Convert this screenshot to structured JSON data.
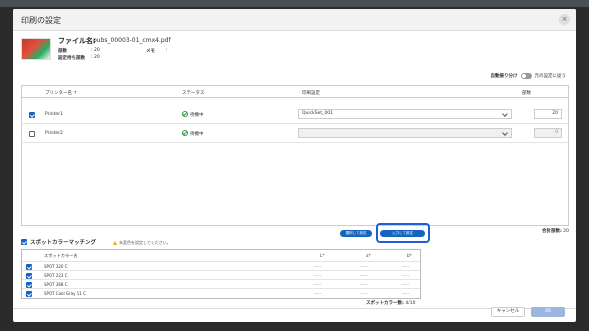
{
  "dialog": {
    "title": "印刷の設定",
    "close_label": "×"
  },
  "file": {
    "label": "ファイル名:",
    "name": "pubs_00003-01_cmx4.pdf",
    "copies_label": "部数",
    "copies_value": "20",
    "memo_label": "メモ",
    "memo_value": ":",
    "quota_label": "設定待ち部数",
    "quota_value": "20"
  },
  "auto_assign": {
    "label": "自動振り分け",
    "value_label": "元の設定に従う"
  },
  "printers": {
    "columns": [
      "プリンター名 ↑",
      "ステータス",
      "印刷設定",
      "部数"
    ],
    "rows": [
      {
        "checked": true,
        "name": "Printer1",
        "status": "待機中",
        "setting": "QuickSet_001",
        "copies": "20",
        "disabled": false
      },
      {
        "checked": false,
        "name": "Printer2",
        "status": "待機中",
        "setting": "",
        "copies": "0",
        "disabled": true
      }
    ]
  },
  "total": {
    "label": "合計部数:",
    "value": "20"
  },
  "spot_color": {
    "title": "スポットカラーマッチング",
    "warning": "未変色を設定してください。",
    "btn_select": "選択して設定",
    "btn_input": "入力して設定",
    "columns": [
      "スポットカラー名",
      "L*",
      "a*",
      "b*"
    ],
    "rows": [
      {
        "checked": true,
        "name": "SPOT 320 C",
        "l": "-----",
        "a": "-----",
        "b": "-----"
      },
      {
        "checked": true,
        "name": "SPOT 223 C",
        "l": "-----",
        "a": "-----",
        "b": "-----"
      },
      {
        "checked": true,
        "name": "SPOT 368 C",
        "l": "-----",
        "a": "-----",
        "b": "-----"
      },
      {
        "checked": true,
        "name": "SPOT Cool Gray 11 C",
        "l": "-----",
        "a": "-----",
        "b": "-----"
      }
    ],
    "count_label": "スポットカラー数:",
    "count_value": "4/10"
  },
  "footer": {
    "cancel": "キャンセル",
    "ok": "OK"
  },
  "colors": {
    "accent": "#1565c0",
    "highlight": "#1e5fd8",
    "status_ok": "#2e9e4a",
    "warning": "#f0a500"
  }
}
